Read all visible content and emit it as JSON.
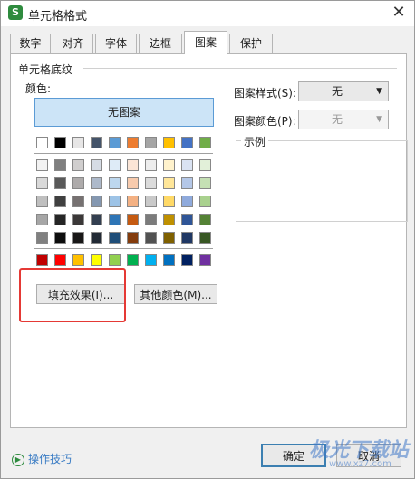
{
  "window": {
    "title": "单元格格式",
    "icon_letter": "S"
  },
  "tabs": [
    "数字",
    "对齐",
    "字体",
    "边框",
    "图案",
    "保护"
  ],
  "active_tab": "图案",
  "shading": {
    "group_title": "单元格底纹",
    "color_label": "颜色:",
    "no_pattern_label": "无图案",
    "fill_effects_label": "填充效果(I)...",
    "more_colors_label": "其他颜色(M)...",
    "palette_row1": [
      "#ffffff",
      "#000000",
      "#e7e6e6",
      "#44546a",
      "#5b9bd5",
      "#ed7d31",
      "#a5a5a5",
      "#ffc000",
      "#4472c4",
      "#70ad47"
    ],
    "palette_tints": [
      [
        "#f2f2f2",
        "#7f7f7f",
        "#d0cece",
        "#d6dce5",
        "#deebf7",
        "#fbe5d6",
        "#ededed",
        "#fff2cc",
        "#dae3f3",
        "#e2f0d9"
      ],
      [
        "#d9d9d9",
        "#595959",
        "#aeabab",
        "#adb9ca",
        "#bdd7ee",
        "#f8cbad",
        "#dbdbdb",
        "#ffe699",
        "#b4c7e7",
        "#c5e0b4"
      ],
      [
        "#bfbfbf",
        "#404040",
        "#767171",
        "#8497b0",
        "#9dc3e6",
        "#f4b183",
        "#c9c9c9",
        "#ffd966",
        "#8faadc",
        "#a9d18e"
      ],
      [
        "#a6a6a6",
        "#262626",
        "#3b3838",
        "#333f50",
        "#2e75b6",
        "#c55a11",
        "#7b7b7b",
        "#bf9000",
        "#2f5597",
        "#548235"
      ],
      [
        "#808080",
        "#0d0d0d",
        "#181717",
        "#222a35",
        "#1f4e79",
        "#843c0c",
        "#525252",
        "#7f6000",
        "#203864",
        "#385723"
      ]
    ],
    "palette_standard": [
      "#c00000",
      "#ff0000",
      "#ffc000",
      "#ffff00",
      "#92d050",
      "#00b050",
      "#00b0f0",
      "#0070c0",
      "#002060",
      "#7030a0"
    ]
  },
  "pattern_style": {
    "label": "图案样式(S):",
    "value": "无"
  },
  "pattern_color": {
    "label": "图案颜色(P):",
    "value": "无"
  },
  "sample_label": "示例",
  "footer": {
    "help_label": "操作技巧",
    "ok_label": "确定",
    "cancel_label": "取消"
  },
  "watermark": {
    "text": "极光下载站",
    "url": "www.xz7.com"
  }
}
